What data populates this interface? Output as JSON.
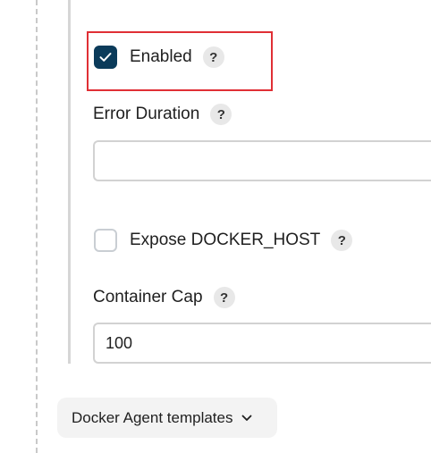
{
  "fields": {
    "enabled": {
      "label": "Enabled",
      "checked": true,
      "help": "?"
    },
    "error_duration": {
      "label": "Error Duration",
      "value": "",
      "help": "?"
    },
    "expose_docker_host": {
      "label": "Expose DOCKER_HOST",
      "checked": false,
      "help": "?"
    },
    "container_cap": {
      "label": "Container Cap",
      "value": "100",
      "help": "?"
    }
  },
  "dropdown": {
    "label": "Docker Agent templates",
    "icon": "chevron-down-icon"
  },
  "colors": {
    "checkbox_checked": "#0b3b5a",
    "highlight_border": "#e02f35"
  }
}
